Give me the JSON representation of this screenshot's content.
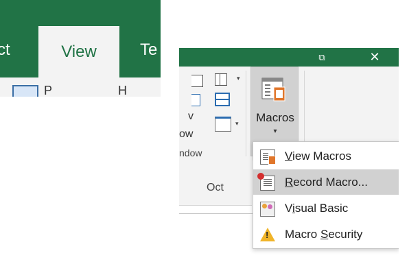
{
  "tabs": {
    "left_partial": "ct",
    "active": "View",
    "right_partial": "Te"
  },
  "left_ribbon": {
    "frag1": "P",
    "frag2": "H"
  },
  "window": {
    "restore_glyph": "⧉",
    "close_glyph": "✕"
  },
  "ribbon": {
    "frag_v": "v",
    "frag_ow": "ow",
    "group_label": "ndow",
    "macros_button": {
      "label": "Macros",
      "caret": "▾"
    },
    "caret": "▾"
  },
  "sheet": {
    "column_label": "Oct"
  },
  "menu": {
    "items": [
      {
        "label_pre": "",
        "label_ul": "V",
        "label_post": "iew Macros",
        "icon": "view-macros-icon"
      },
      {
        "label_pre": "",
        "label_ul": "R",
        "label_post": "ecord Macro...",
        "icon": "record-macro-icon"
      },
      {
        "label_pre": "V",
        "label_ul": "i",
        "label_post": "sual Basic",
        "icon": "visual-basic-icon"
      },
      {
        "label_pre": "Macro ",
        "label_ul": "S",
        "label_post": "ecurity",
        "icon": "warning-icon"
      }
    ]
  },
  "colors": {
    "accent": "#217346",
    "ribbon_bg": "#f3f3f3",
    "hover": "#d1d1d1"
  }
}
